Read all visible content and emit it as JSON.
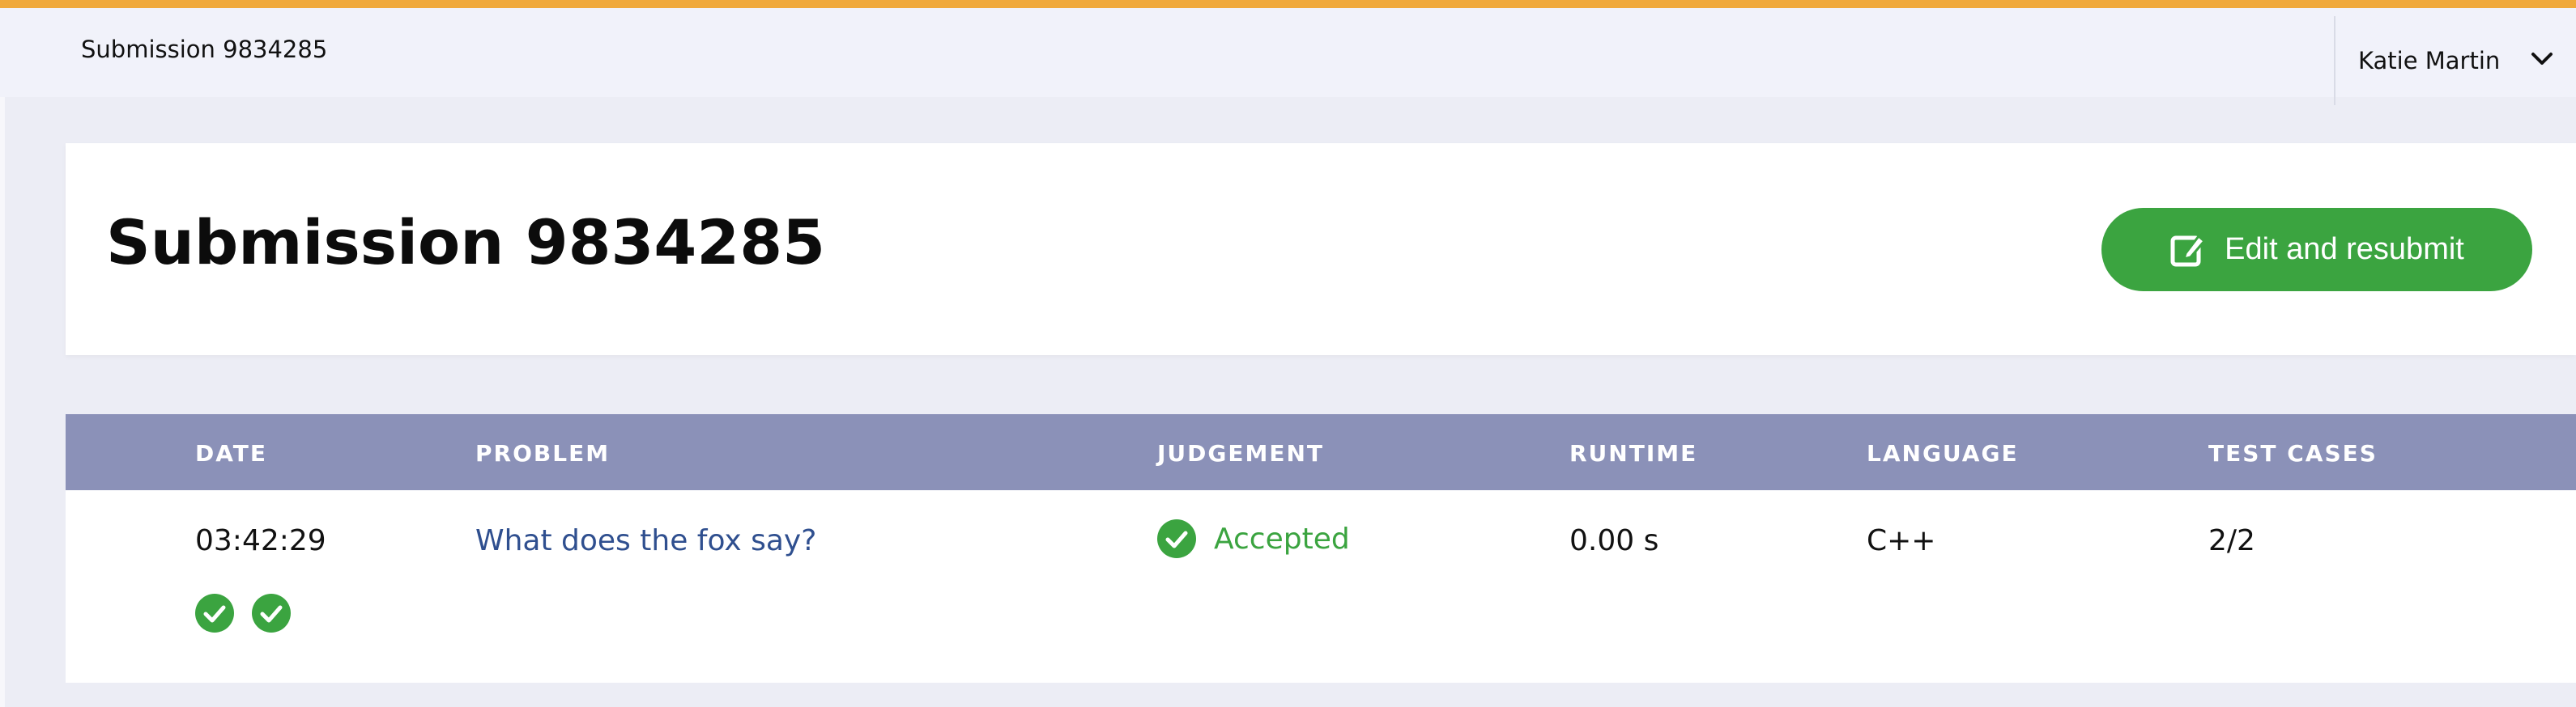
{
  "topbar": {
    "breadcrumb": "Submission 9834285",
    "user_name": "Katie Martin",
    "accent_color": "#f0a93b"
  },
  "header": {
    "title": "Submission 9834285",
    "resubmit_label": "Edit and resubmit",
    "resubmit_icon": "edit-icon",
    "button_color": "#3ba440"
  },
  "table": {
    "header_color": "#8b91b8",
    "columns": {
      "date": "DATE",
      "problem": "PROBLEM",
      "judgement": "JUDGEMENT",
      "runtime": "RUNTIME",
      "language": "LANGUAGE",
      "test_cases": "TEST CASES"
    },
    "rows": [
      {
        "date": "03:42:29",
        "problem": "What does the fox say?",
        "judgement": "Accepted",
        "runtime": "0.00 s",
        "language": "C++",
        "test_cases": "2/2",
        "test_case_icons": [
          "check-circle-icon",
          "check-circle-icon"
        ]
      }
    ]
  }
}
